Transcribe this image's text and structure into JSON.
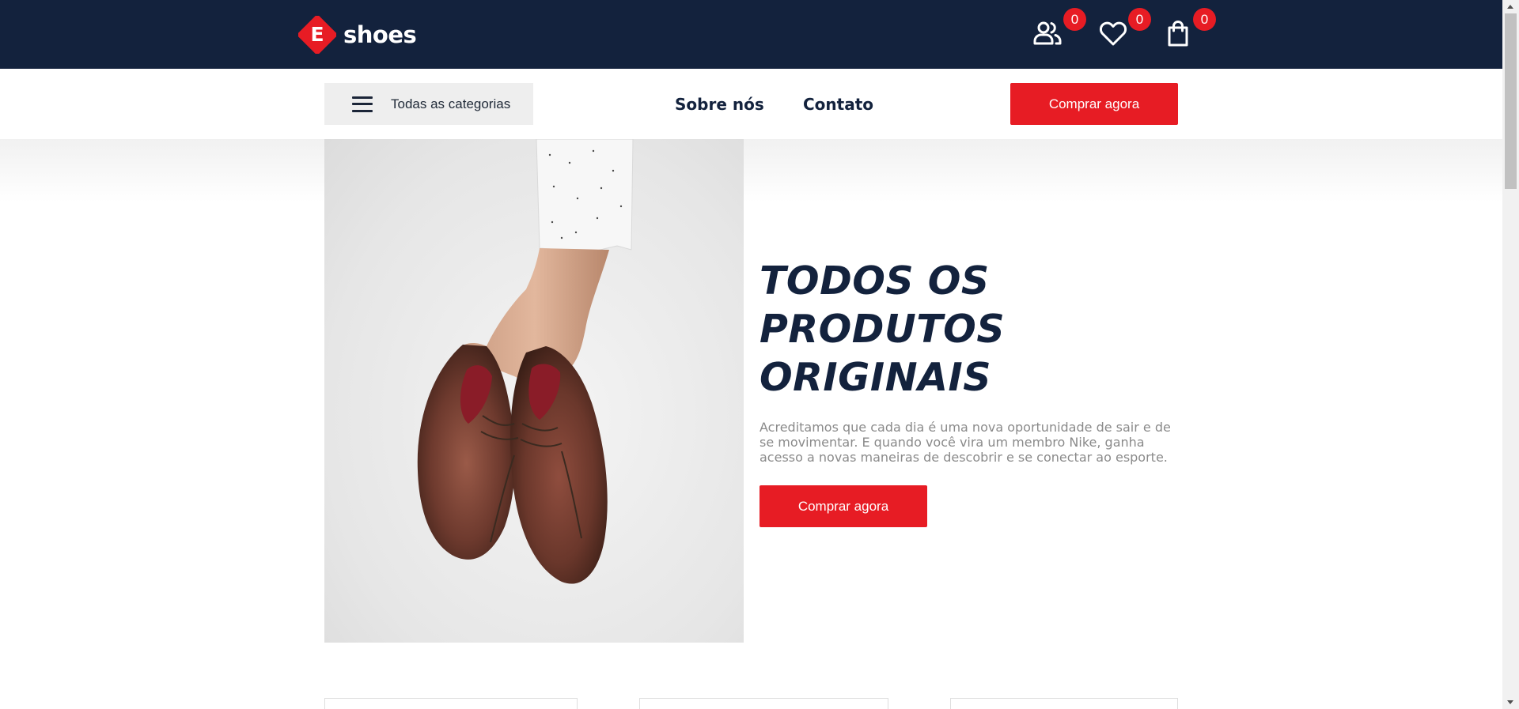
{
  "brand": {
    "logo_letter": "E",
    "name": "shoes",
    "logo_color": "#e71c24"
  },
  "header": {
    "bg_color": "#13223d",
    "icons": [
      {
        "name": "users-icon",
        "count": "0"
      },
      {
        "name": "heart-icon",
        "count": "0"
      },
      {
        "name": "shopping-bag-icon",
        "count": "0"
      }
    ]
  },
  "nav": {
    "categories_label": "Todas as categorias",
    "links": [
      "Sobre nós",
      "Contato"
    ],
    "cta_label": "Comprar agora"
  },
  "hero": {
    "title_lines": [
      "TODOS OS",
      "PRODUTOS",
      "ORIGINAIS"
    ],
    "description": "Acreditamos que cada dia é uma nova oportunidade de sair e de se movimentar. E quando você vira um membro Nike, ganha acesso a novas maneiras de descobrir e se conectar ao esporte.",
    "cta_label": "Comprar agora",
    "image": "hand-holding-brown-shoes-photo"
  },
  "colors": {
    "accent": "#e71c24",
    "navy": "#13223d",
    "muted_text": "#8a8a8a"
  }
}
